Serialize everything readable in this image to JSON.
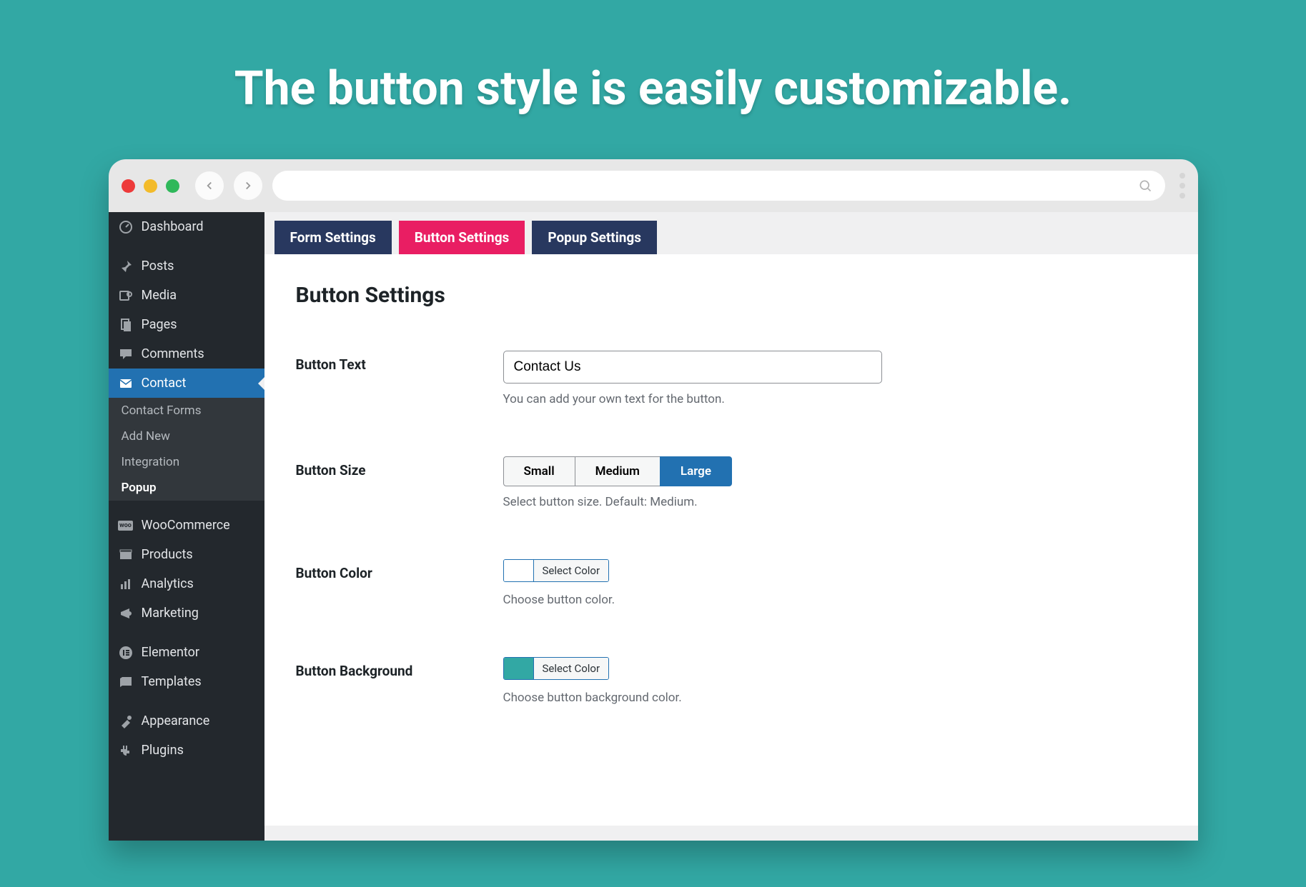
{
  "headline": "The button style is easily customizable.",
  "sidebar": {
    "items": [
      {
        "label": "Dashboard",
        "icon": "dashboard"
      },
      {
        "label": "Posts",
        "icon": "pin"
      },
      {
        "label": "Media",
        "icon": "media"
      },
      {
        "label": "Pages",
        "icon": "pages"
      },
      {
        "label": "Comments",
        "icon": "comments"
      },
      {
        "label": "Contact",
        "icon": "mail"
      },
      {
        "label": "WooCommerce",
        "icon": "woo"
      },
      {
        "label": "Products",
        "icon": "products"
      },
      {
        "label": "Analytics",
        "icon": "analytics"
      },
      {
        "label": "Marketing",
        "icon": "marketing"
      },
      {
        "label": "Elementor",
        "icon": "elementor"
      },
      {
        "label": "Templates",
        "icon": "templates"
      },
      {
        "label": "Appearance",
        "icon": "appearance"
      },
      {
        "label": "Plugins",
        "icon": "plugins"
      }
    ],
    "submenu": [
      {
        "label": "Contact Forms"
      },
      {
        "label": "Add New"
      },
      {
        "label": "Integration"
      },
      {
        "label": "Popup"
      }
    ]
  },
  "tabs": [
    {
      "label": "Form Settings"
    },
    {
      "label": "Button Settings"
    },
    {
      "label": "Popup Settings"
    }
  ],
  "panel": {
    "title": "Button Settings",
    "rows": {
      "text": {
        "label": "Button Text",
        "value": "Contact Us",
        "helper": "You can add your own text for the button."
      },
      "size": {
        "label": "Button Size",
        "options": [
          "Small",
          "Medium",
          "Large"
        ],
        "helper": "Select button size. Default: Medium."
      },
      "color": {
        "label": "Button Color",
        "button": "Select Color",
        "helper": "Choose button color."
      },
      "bg": {
        "label": "Button Background",
        "button": "Select Color",
        "helper": "Choose button background color."
      }
    }
  }
}
